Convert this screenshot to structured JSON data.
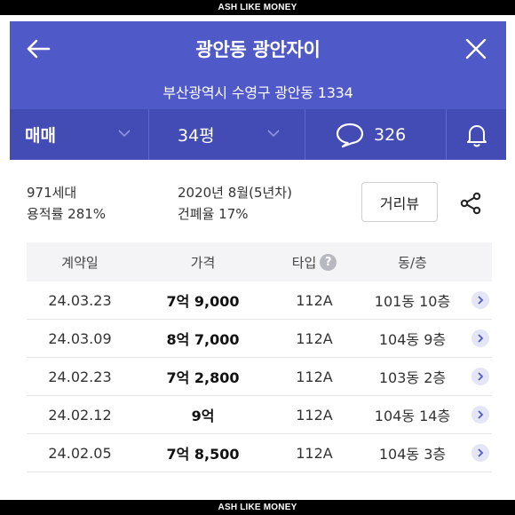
{
  "watermark": "ASH LIKE MONEY",
  "header": {
    "title": "광안동 광안자이",
    "address": "부산광역시 수영구 광안동 1334"
  },
  "filters": {
    "trade_type": "매매",
    "size": "34평",
    "comment_count": "326"
  },
  "summary": {
    "households": "971세대",
    "floor_area_ratio": "용적률 281%",
    "built": "2020년 8월(5년차)",
    "building_coverage": "건폐율 17%",
    "street_view_label": "거리뷰"
  },
  "table": {
    "headers": {
      "date": "계약일",
      "price": "가격",
      "type": "타입",
      "unit": "동/층"
    },
    "rows": [
      {
        "date": "24.03.23",
        "price": "7억 9,000",
        "type": "112A",
        "unit": "101동 10층"
      },
      {
        "date": "24.03.09",
        "price": "8억 7,000",
        "type": "112A",
        "unit": "104동 9층"
      },
      {
        "date": "24.02.23",
        "price": "7억 2,800",
        "type": "112A",
        "unit": "103동 2층"
      },
      {
        "date": "24.02.12",
        "price": "9억",
        "type": "112A",
        "unit": "104동 14층"
      },
      {
        "date": "24.02.05",
        "price": "7억 8,500",
        "type": "112A",
        "unit": "104동 3층"
      }
    ]
  },
  "colors": {
    "header_bg": "#5059c8",
    "filter_bg": "#434bb5",
    "accent": "#5059c8"
  }
}
